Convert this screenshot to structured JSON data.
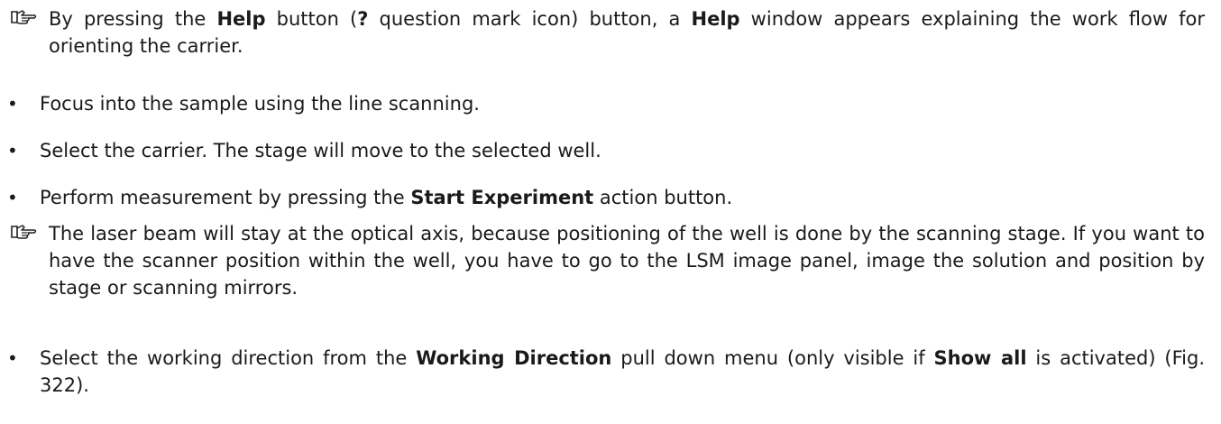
{
  "doc": {
    "note1": {
      "icon": "pointing-hand-icon",
      "a": "By pressing the ",
      "b1": "Help",
      "c": " button (",
      "b2": "?",
      "d": " question mark icon) button, a ",
      "b3": "Help",
      "e": " window appears explaining the work flow for orienting the carrier."
    },
    "bullet_char": "•",
    "bullet1": "Focus into the sample using the line scanning.",
    "bullet2": "Select the carrier. The stage will move to the selected well.",
    "bullet3": {
      "a": "Perform measurement by pressing the ",
      "b": "Start Experiment",
      "c": " action button."
    },
    "note2": {
      "icon": "pointing-hand-icon",
      "text": "The laser beam will stay at the optical axis, because positioning of the well is done by the scanning stage. If you want to have the scanner position within the well, you have to go to the LSM image panel, image the solution and position by stage or scanning mirrors."
    },
    "bullet4": {
      "a": "Select the working direction from the ",
      "b": "Working Direction",
      "c": " pull down menu (only visible if ",
      "d": "Show all",
      "e": " is activated) (Fig. 322)."
    }
  }
}
